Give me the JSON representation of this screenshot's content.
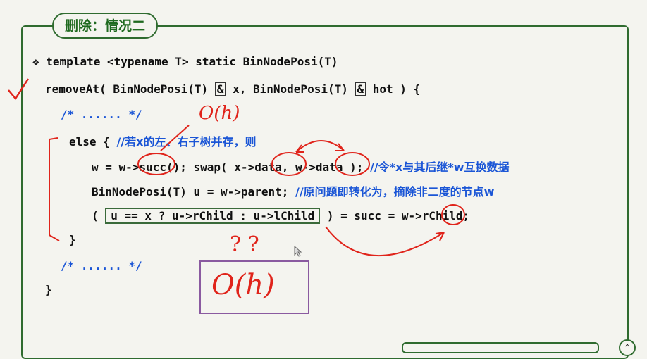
{
  "slide": {
    "title": "删除：情况二"
  },
  "code": {
    "bullet": "❖",
    "l1": "template <typename T> static BinNodePosi(T)",
    "l2_fn": "removeAt",
    "l2_a": "( BinNodePosi(T) ",
    "l2_amp1": "&",
    "l2_b": " x, BinNodePosi(T) ",
    "l2_amp2": "&",
    "l2_c": " hot ) {",
    "l3": "/* ...... */",
    "l4_code": "else { ",
    "l4_comment": "//若x的左、右子树并存，则",
    "l5_a": "w = w->",
    "l5_succ": "succ",
    "l5_b": "(); swap( x->data, w->data ); ",
    "l5_comment": "//令*x与其后继*w互换数据",
    "l6_code": "BinNodePosi(T) u = w->parent; ",
    "l6_comment": "//原问题即转化为，摘除非二度的节点w",
    "l7_a": "( ",
    "l7_cond": "u == x ? u->rChild : u->lChild",
    "l7_b": " ) = succ = w->rChild;",
    "l8": "}",
    "l9": "/* ...... */",
    "l10": "}"
  },
  "annotations": {
    "oh_small": "O(h)",
    "question": "? ?",
    "oh_big": "O(h)"
  },
  "colors": {
    "frame": "#2f6b2f",
    "comment": "#1a55d6",
    "ink_red": "#e0241b",
    "ink_purple": "#8a5aa0"
  }
}
